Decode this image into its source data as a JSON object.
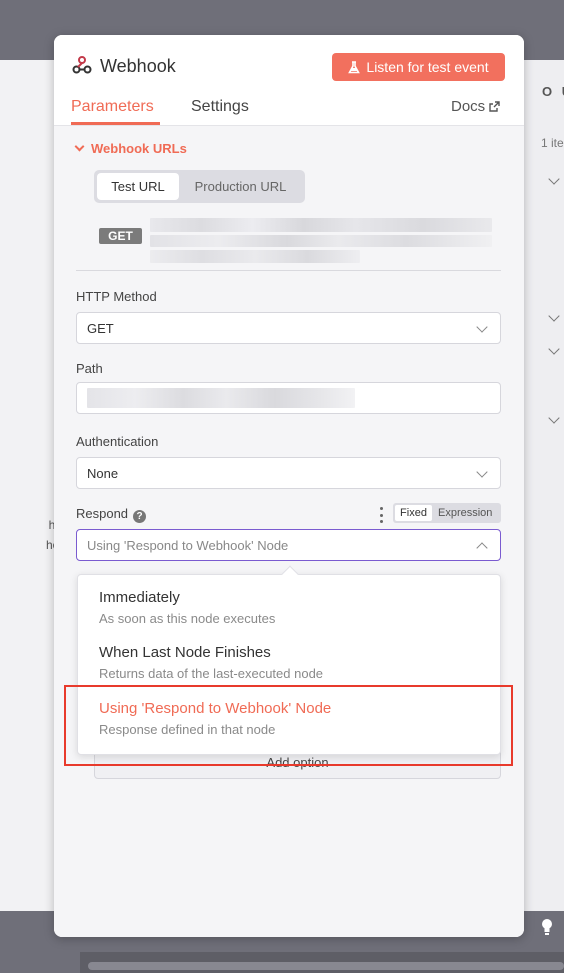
{
  "background": {
    "left_text": [
      "hout",
      "hook"
    ],
    "right_output_label": "O U",
    "right_item_count": "1 ite"
  },
  "header": {
    "title": "Webhook",
    "listen_button": "Listen for test event",
    "tabs": [
      {
        "label": "Parameters",
        "active": true
      },
      {
        "label": "Settings",
        "active": false
      }
    ],
    "docs_label": "Docs"
  },
  "webhook_urls": {
    "label": "Webhook URLs",
    "options": [
      "Test URL",
      "Production URL"
    ],
    "selected": "Test URL",
    "method_badge": "GET"
  },
  "fields": {
    "http_method": {
      "label": "HTTP Method",
      "value": "GET"
    },
    "path": {
      "label": "Path"
    },
    "authentication": {
      "label": "Authentication",
      "value": "None"
    },
    "respond": {
      "label": "Respond",
      "help": "?",
      "mode_fixed": "Fixed",
      "mode_expression": "Expression",
      "value": "Using 'Respond to Webhook' Node"
    }
  },
  "add_option_label": "Add option",
  "respond_dropdown": {
    "items": [
      {
        "name": "Immediately",
        "description": "As soon as this node executes"
      },
      {
        "name": "When Last Node Finishes",
        "description": "Returns data of the last-executed node"
      },
      {
        "name": "Using 'Respond to Webhook' Node",
        "description": "Response defined in that node",
        "selected": true
      }
    ]
  },
  "colors": {
    "accent": "#f06b55",
    "button": "#f2705e",
    "highlight_box": "#e83a2c",
    "focus_border": "#7a5bd0"
  }
}
